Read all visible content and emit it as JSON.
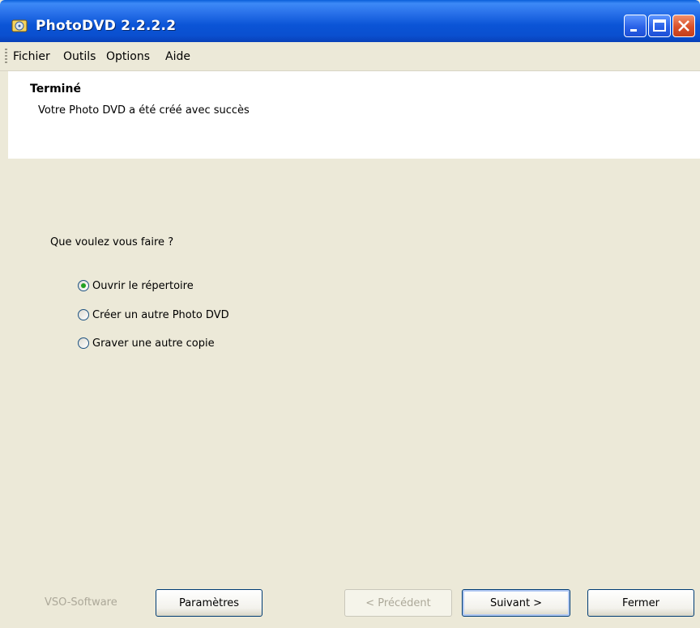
{
  "window": {
    "title": "PhotoDVD 2.2.2.2",
    "colors": {
      "titlebar": "#0a54d6",
      "body": "#ece9d8",
      "close": "#d9502a"
    }
  },
  "menu": [
    "Fichier",
    "Outils",
    "Options",
    "Aide"
  ],
  "header": {
    "title": "Terminé",
    "subtitle": "Votre Photo DVD a été créé avec succès"
  },
  "content": {
    "question": "Que voulez vous faire ?",
    "options": [
      {
        "label": "Ouvrir le répertoire",
        "checked": true
      },
      {
        "label": "Créer un autre Photo DVD",
        "checked": false
      },
      {
        "label": "Graver une autre copie",
        "checked": false
      }
    ]
  },
  "footer": {
    "brand": "VSO-Software",
    "settings_label": "Paramètres",
    "previous_label": "< Précédent",
    "next_label": "Suivant >",
    "close_label": "Fermer"
  },
  "icons": {
    "app": "photodvd-app-icon",
    "minimize": "minimize-icon",
    "maximize": "maximize-icon",
    "close": "close-icon"
  }
}
